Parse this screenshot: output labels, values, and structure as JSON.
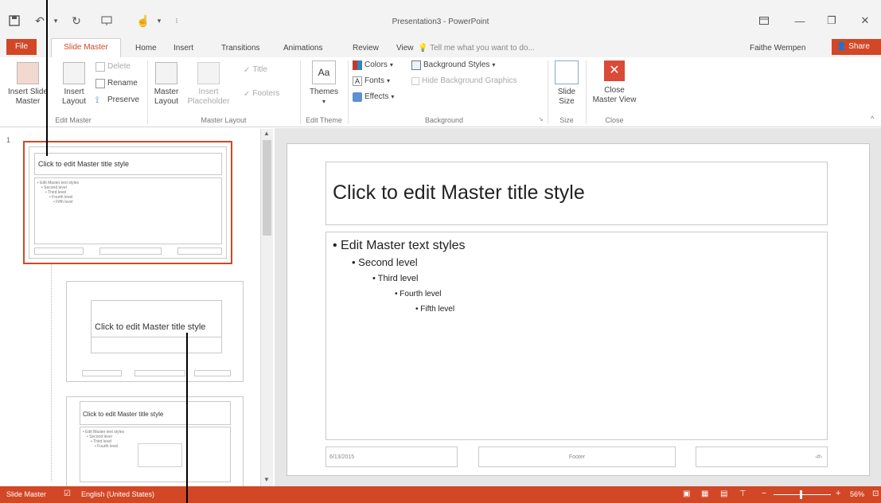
{
  "window": {
    "title": "Presentation3 - PowerPoint",
    "user": "Faithe Wempen",
    "share": "Share",
    "tell_me": "Tell me what you want to do..."
  },
  "tabs": [
    "File",
    "Slide Master",
    "Home",
    "Insert",
    "Transitions",
    "Animations",
    "Review",
    "View"
  ],
  "ribbon": {
    "edit_master": {
      "label": "Edit Master",
      "insert_slide_master": [
        "Insert Slide",
        "Master"
      ],
      "insert_layout": [
        "Insert",
        "Layout"
      ],
      "delete": "Delete",
      "rename": "Rename",
      "preserve": "Preserve"
    },
    "master_layout": {
      "label": "Master Layout",
      "master_layout": [
        "Master",
        "Layout"
      ],
      "insert_placeholder": [
        "Insert",
        "Placeholder"
      ],
      "title": "Title",
      "footers": "Footers"
    },
    "edit_theme": {
      "label": "Edit Theme",
      "themes": "Themes"
    },
    "background": {
      "label": "Background",
      "colors": "Colors",
      "fonts": "Fonts",
      "effects": "Effects",
      "background_styles": "Background Styles",
      "hide_background": "Hide Background Graphics"
    },
    "size": {
      "label": "Size",
      "slide_size": [
        "Slide",
        "Size"
      ]
    },
    "close": {
      "label": "Close",
      "close_master": [
        "Close",
        "Master View"
      ]
    }
  },
  "thumbnails": {
    "number": "1",
    "thumb1_title": "Click to edit Master title style",
    "thumb1_lines": [
      "• Edit Master text styles",
      "  • Second level",
      "    • Third level",
      "      • Fourth level",
      "        • Fifth level"
    ],
    "thumb2_title": "Click to edit Master title style",
    "thumb3_title": "Click to edit Master title style"
  },
  "slide": {
    "title": "Click to edit Master title style",
    "levels": [
      "Edit Master text styles",
      "Second level",
      "Third level",
      "Fourth level",
      "Fifth level"
    ],
    "date": "6/13/2015",
    "footer": "Footer",
    "page": "‹#›"
  },
  "status": {
    "mode": "Slide Master",
    "language": "English (United States)",
    "zoom": "56%"
  }
}
